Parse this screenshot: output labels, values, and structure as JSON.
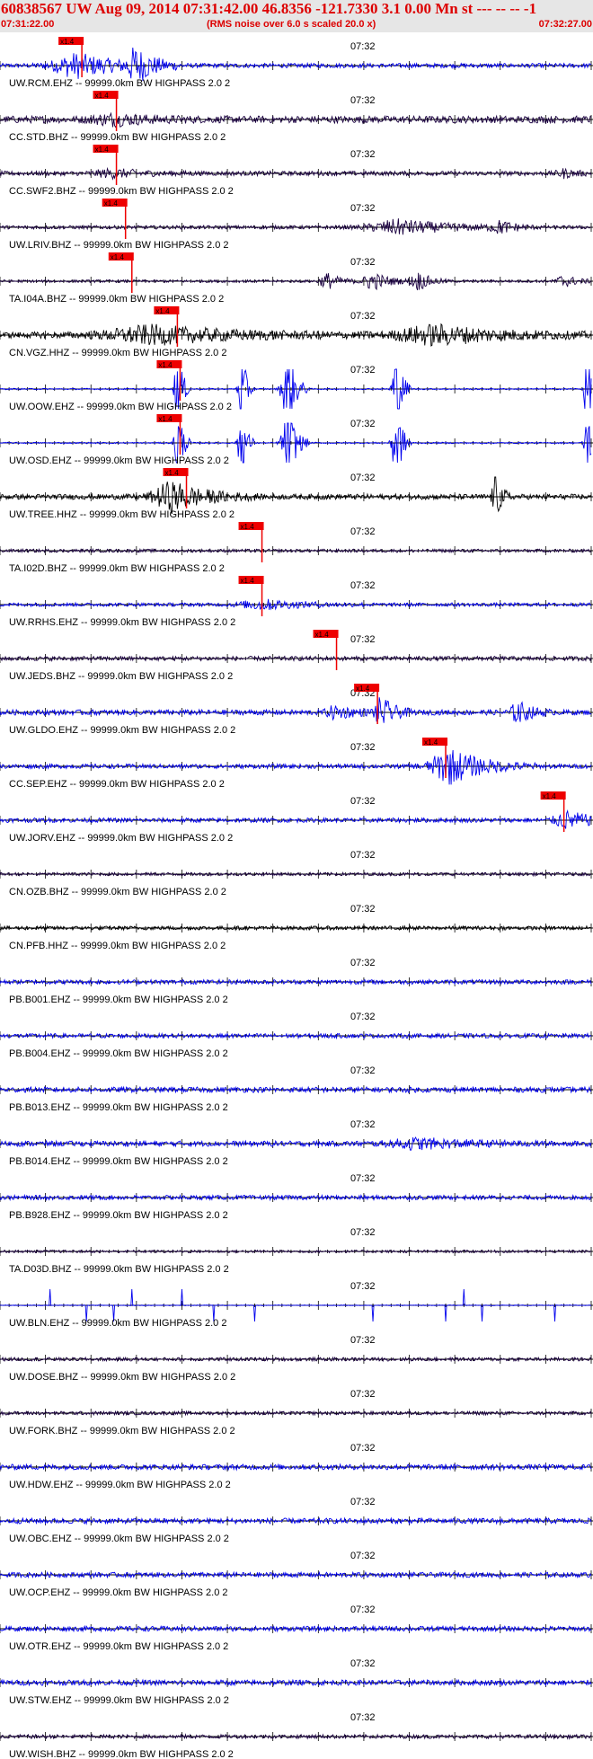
{
  "header": {
    "title": "60838567 UW Aug 09, 2014 07:31:42.00   46.8356 -121.7330  3.1 0.00 Mn st --- -- --  -1",
    "subtitle": "(RMS noise over 6.0 s scaled 20.0 x)",
    "start_time": "07:31:22.00",
    "end_time": "07:32:27.00"
  },
  "chart_data": {
    "type": "line",
    "title": "60838567 UW Aug 09, 2014 07:31:42.00   46.8356 -121.7330  3.1 0.00 Mn st --- -- --  -1",
    "x_unit": "seconds after 07:31:22.00",
    "xlim": [
      0,
      65
    ],
    "mid_tick_label": "07:32",
    "pick_label": "x1.4",
    "colors": {
      "title": "#dd0000",
      "pick": "#ee0000",
      "axis": "#000000"
    },
    "traces": [
      {
        "label": "UW.RCM.EHZ -- 99999.0km BW  HIGHPASS  2.0  2",
        "color": "#0000ee",
        "pick_s": 9.0,
        "amp": 0.25,
        "bursts": [
          [
            8.5,
            10,
            1.3
          ],
          [
            15,
            4,
            1.8
          ]
        ]
      },
      {
        "label": "CC.STD.BHZ -- 99999.0km BW  HIGHPASS  2.0  2",
        "color": "#1a0040",
        "pick_s": 12.8,
        "amp": 0.4,
        "bursts": [
          [
            12.5,
            8,
            0.5
          ]
        ]
      },
      {
        "label": "CC.SWF2.BHZ -- 99999.0km BW  HIGHPASS  2.0  2",
        "color": "#1a0040",
        "pick_s": 12.8,
        "amp": 0.25,
        "bursts": [
          [
            12.5,
            8,
            0.4
          ],
          [
            62,
            3,
            0.4
          ]
        ]
      },
      {
        "label": "UW.LRIV.BHZ -- 99999.0km BW  HIGHPASS  2.0  2",
        "color": "#1a0040",
        "pick_s": 13.8,
        "amp": 0.2,
        "bursts": [
          [
            44,
            12,
            0.8
          ],
          [
            55,
            4,
            0.6
          ]
        ]
      },
      {
        "label": "TA.I04A.BHZ -- 99999.0km BW  HIGHPASS  2.0  2",
        "color": "#1a0040",
        "pick_s": 14.5,
        "amp": 0.15,
        "bursts": [
          [
            36,
            3,
            0.9
          ],
          [
            41,
            4,
            1.0
          ],
          [
            46,
            3,
            1.0
          ],
          [
            62,
            3,
            0.7
          ]
        ]
      },
      {
        "label": "CN.VGZ.HHZ -- 99999.0km BW  HIGHPASS  2.0  2",
        "color": "#000000",
        "pick_s": 19.5,
        "amp": 0.35,
        "bursts": [
          [
            17,
            20,
            0.9
          ],
          [
            48,
            16,
            1.0
          ]
        ]
      },
      {
        "label": "UW.OOW.EHZ -- 99999.0km BW  HIGHPASS  2.0  2",
        "color": "#0000ee",
        "pick_s": 19.8,
        "amp": 0.08,
        "bursts": [
          [
            19.5,
            1.2,
            5
          ],
          [
            26.5,
            1.2,
            5
          ],
          [
            31.5,
            2,
            5
          ],
          [
            43.5,
            1.5,
            5
          ],
          [
            64.5,
            1,
            5
          ]
        ]
      },
      {
        "label": "UW.OSD.EHZ -- 99999.0km BW  HIGHPASS  2.0  2",
        "color": "#0000ee",
        "pick_s": 19.8,
        "amp": 0.08,
        "bursts": [
          [
            19.5,
            1.2,
            5
          ],
          [
            26.5,
            1.2,
            5
          ],
          [
            31.5,
            2,
            5
          ],
          [
            43.5,
            1.5,
            5
          ],
          [
            64.5,
            1,
            5
          ]
        ]
      },
      {
        "label": "UW.TREE.HHZ -- 99999.0km BW  HIGHPASS  2.0  2",
        "color": "#000000",
        "pick_s": 20.5,
        "amp": 0.3,
        "bursts": [
          [
            19,
            8,
            1.6
          ],
          [
            54.5,
            1.5,
            2.5
          ]
        ]
      },
      {
        "label": "TA.I02D.BHZ -- 99999.0km BW  HIGHPASS  2.0  2",
        "color": "#1a0040",
        "pick_s": 28.8,
        "amp": 0.18,
        "bursts": []
      },
      {
        "label": "UW.RRHS.EHZ -- 99999.0km BW  HIGHPASS  2.0  2",
        "color": "#0000ee",
        "pick_s": 28.8,
        "amp": 0.2,
        "bursts": [
          [
            29,
            10,
            0.5
          ]
        ]
      },
      {
        "label": "UW.JEDS.BHZ -- 99999.0km BW  HIGHPASS  2.0  2",
        "color": "#1a0040",
        "pick_s": 37.0,
        "amp": 0.25,
        "bursts": []
      },
      {
        "label": "UW.GLDO.EHZ -- 99999.0km BW  HIGHPASS  2.0  2",
        "color": "#0000ee",
        "pick_s": 41.5,
        "amp": 0.3,
        "bursts": [
          [
            37,
            4,
            0.7
          ],
          [
            42,
            3,
            1.6
          ],
          [
            57,
            3,
            1.2
          ]
        ]
      },
      {
        "label": "CC.SEP.EHZ -- 99999.0km BW  HIGHPASS  2.0  2",
        "color": "#0000ee",
        "pick_s": 49.0,
        "amp": 0.25,
        "bursts": [
          [
            49.5,
            8,
            1.9
          ]
        ]
      },
      {
        "label": "UW.JORV.EHZ -- 99999.0km BW  HIGHPASS  2.0  2",
        "color": "#0000ee",
        "pick_s": 62.0,
        "amp": 0.25,
        "bursts": [
          [
            62.5,
            6,
            0.9
          ]
        ]
      },
      {
        "label": "CN.OZB.BHZ -- 99999.0km BW  HIGHPASS  2.0  2",
        "color": "#1a0040",
        "pick_s": null,
        "amp": 0.18,
        "bursts": []
      },
      {
        "label": "CN.PFB.HHZ -- 99999.0km BW  HIGHPASS  2.0  2",
        "color": "#000000",
        "pick_s": null,
        "amp": 0.22,
        "bursts": []
      },
      {
        "label": "PB.B001.EHZ -- 99999.0km BW  HIGHPASS  2.0  2",
        "color": "#0000ee",
        "pick_s": null,
        "amp": 0.25,
        "bursts": []
      },
      {
        "label": "PB.B004.EHZ -- 99999.0km BW  HIGHPASS  2.0  2",
        "color": "#0000ee",
        "pick_s": null,
        "amp": 0.25,
        "bursts": []
      },
      {
        "label": "PB.B013.EHZ -- 99999.0km BW  HIGHPASS  2.0  2",
        "color": "#0000ee",
        "pick_s": null,
        "amp": 0.3,
        "bursts": []
      },
      {
        "label": "PB.B014.EHZ -- 99999.0km BW  HIGHPASS  2.0  2",
        "color": "#0000ee",
        "pick_s": null,
        "amp": 0.3,
        "bursts": [
          [
            46,
            12,
            0.5
          ]
        ]
      },
      {
        "label": "PB.B928.EHZ -- 99999.0km BW  HIGHPASS  2.0  2",
        "color": "#0000ee",
        "pick_s": null,
        "amp": 0.25,
        "bursts": []
      },
      {
        "label": "TA.D03D.BHZ -- 99999.0km BW  HIGHPASS  2.0  2",
        "color": "#1a0040",
        "pick_s": null,
        "amp": 0.15,
        "bursts": []
      },
      {
        "label": "UW.BLN.EHZ -- 99999.0km BW  HIGHPASS  2.0  2",
        "color": "#0000ee",
        "pick_s": null,
        "amp": 0.04,
        "spikes": [
          5.5,
          9.5,
          12.5,
          14.5,
          20,
          23.5,
          28,
          41,
          49,
          51,
          53,
          61
        ]
      },
      {
        "label": "UW.DOSE.BHZ -- 99999.0km BW  HIGHPASS  2.0  2",
        "color": "#1a0040",
        "pick_s": null,
        "amp": 0.2,
        "bursts": []
      },
      {
        "label": "UW.FORK.BHZ -- 99999.0km BW  HIGHPASS  2.0  2",
        "color": "#1a0040",
        "pick_s": null,
        "amp": 0.2,
        "bursts": []
      },
      {
        "label": "UW.HDW.EHZ -- 99999.0km BW  HIGHPASS  2.0  2",
        "color": "#0000ee",
        "pick_s": null,
        "amp": 0.3,
        "bursts": []
      },
      {
        "label": "UW.OBC.EHZ -- 99999.0km BW  HIGHPASS  2.0  2",
        "color": "#0000ee",
        "pick_s": null,
        "amp": 0.3,
        "bursts": []
      },
      {
        "label": "UW.OCP.EHZ -- 99999.0km BW  HIGHPASS  2.0  2",
        "color": "#0000ee",
        "pick_s": null,
        "amp": 0.28,
        "bursts": []
      },
      {
        "label": "UW.OTR.EHZ -- 99999.0km BW  HIGHPASS  2.0  2",
        "color": "#0000ee",
        "pick_s": null,
        "amp": 0.28,
        "bursts": []
      },
      {
        "label": "UW.STW.EHZ -- 99999.0km BW  HIGHPASS  2.0  2",
        "color": "#0000ee",
        "pick_s": null,
        "amp": 0.3,
        "bursts": []
      },
      {
        "label": "UW.WISH.BHZ -- 99999.0km BW  HIGHPASS  2.0  2",
        "color": "#1a0040",
        "pick_s": null,
        "amp": 0.22,
        "bursts": []
      }
    ]
  }
}
